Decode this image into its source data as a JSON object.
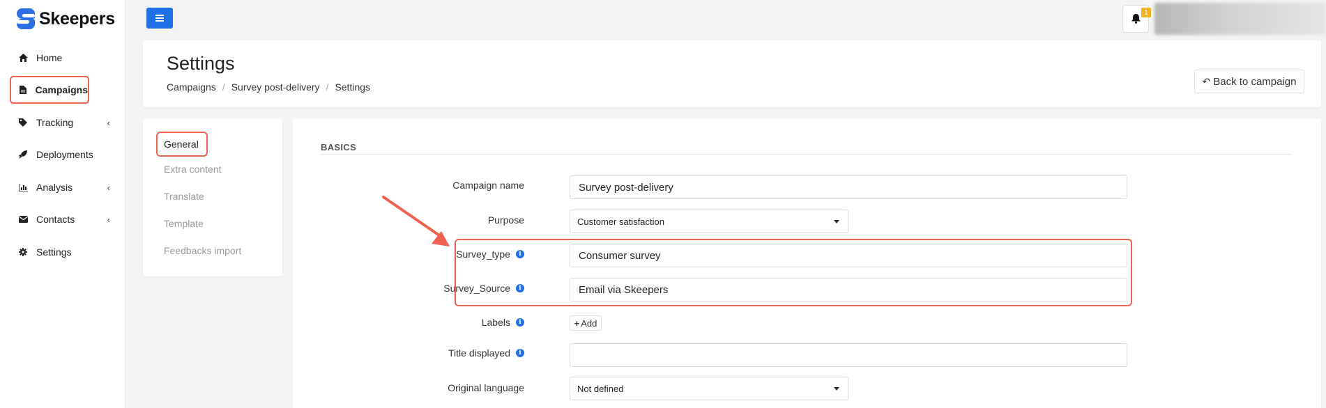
{
  "app": {
    "logo_text": "Skeepers"
  },
  "sidebar": {
    "items": [
      {
        "label": "Home",
        "icon": "home-icon"
      },
      {
        "label": "Campaigns",
        "icon": "file-icon",
        "active": true
      },
      {
        "label": "Tracking",
        "icon": "tag-icon",
        "has_children": true
      },
      {
        "label": "Deployments",
        "icon": "rocket-icon"
      },
      {
        "label": "Analysis",
        "icon": "bar-chart-icon",
        "has_children": true
      },
      {
        "label": "Contacts",
        "icon": "envelope-icon",
        "has_children": true
      },
      {
        "label": "Settings",
        "icon": "gear-icon"
      }
    ]
  },
  "topbar": {
    "notification_count": "1"
  },
  "header": {
    "title": "Settings",
    "breadcrumb": [
      "Campaigns",
      "Survey post-delivery",
      "Settings"
    ],
    "back_label": "Back to campaign"
  },
  "submenu": {
    "items": [
      "General",
      "Extra content",
      "Translate",
      "Template",
      "Feedbacks import"
    ],
    "active": "General"
  },
  "form": {
    "section_title": "BASICS",
    "campaign_name": {
      "label": "Campaign name",
      "value": "Survey post-delivery"
    },
    "purpose": {
      "label": "Purpose",
      "value": "Customer satisfaction"
    },
    "survey_type": {
      "label": "Survey_type",
      "value": "Consumer survey"
    },
    "survey_source": {
      "label": "Survey_Source",
      "value": "Email via Skeepers"
    },
    "labels": {
      "label": "Labels",
      "add_label": "Add"
    },
    "title_displayed": {
      "label": "Title displayed",
      "value": ""
    },
    "original_language": {
      "label": "Original language",
      "value": "Not defined"
    }
  },
  "colors": {
    "accent": "#1f6fe6",
    "highlight": "#f0614f",
    "badge": "#f4b321"
  }
}
